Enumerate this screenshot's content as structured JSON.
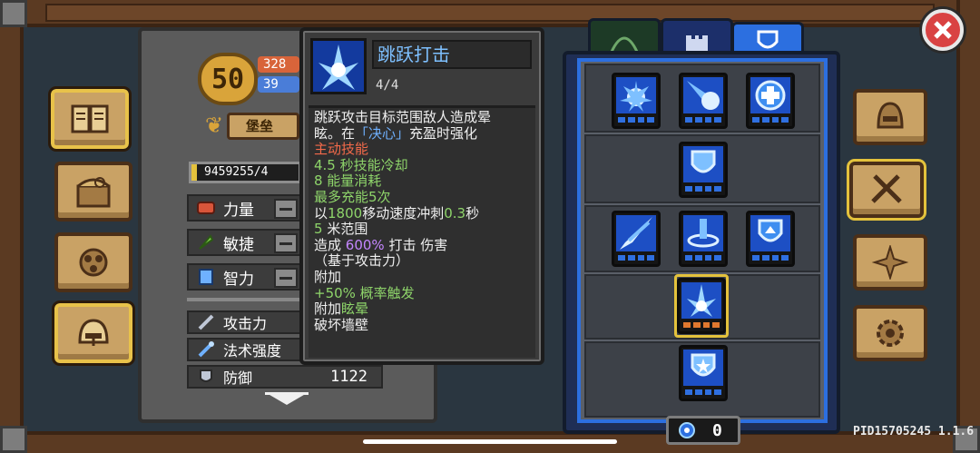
{
  "character": {
    "level": "50",
    "hp": "328",
    "mp": "39",
    "title": "堡垒",
    "experience": "9459255/4",
    "attributes": [
      {
        "label": "力量"
      },
      {
        "label": "敏捷"
      },
      {
        "label": "智力"
      }
    ],
    "stats": [
      {
        "label": "攻击力",
        "value": ""
      },
      {
        "label": "法术强度",
        "value": ""
      },
      {
        "label": "防御",
        "value": "1122"
      }
    ]
  },
  "tooltip": {
    "name": "跳跃打击",
    "level": "4/4",
    "lines": [
      {
        "parts": [
          {
            "t": "跳跃攻击目标范围敌人造成晕",
            "c": ""
          }
        ]
      },
      {
        "parts": [
          {
            "t": "眩。在",
            "c": ""
          },
          {
            "t": "「决心」",
            "c": "c-blue"
          },
          {
            "t": "充盈时强化",
            "c": ""
          }
        ]
      },
      {
        "parts": [
          {
            "t": "主动技能",
            "c": "c-red"
          }
        ]
      },
      {
        "parts": [
          {
            "t": "4.5 秒技能冷却",
            "c": "c-green"
          }
        ]
      },
      {
        "parts": [
          {
            "t": "8 能量消耗",
            "c": "c-green"
          }
        ]
      },
      {
        "parts": [
          {
            "t": "最多充能5次",
            "c": "c-green"
          }
        ]
      },
      {
        "parts": [
          {
            "t": "以",
            "c": ""
          },
          {
            "t": "1800",
            "c": "c-green"
          },
          {
            "t": "移动速度冲刺",
            "c": ""
          },
          {
            "t": "0.3",
            "c": "c-green"
          },
          {
            "t": "秒",
            "c": ""
          }
        ]
      },
      {
        "parts": [
          {
            "t": "5",
            "c": "c-green"
          },
          {
            "t": " 米范围",
            "c": ""
          }
        ]
      },
      {
        "parts": [
          {
            "t": "造成 ",
            "c": ""
          },
          {
            "t": "600%",
            "c": "c-purple"
          },
          {
            "t": " 打击 伤害",
            "c": ""
          }
        ]
      },
      {
        "parts": [
          {
            "t": "（基于攻击力）",
            "c": ""
          }
        ]
      },
      {
        "parts": [
          {
            "t": "附加",
            "c": ""
          }
        ]
      },
      {
        "parts": [
          {
            "t": "+50% 概率触发",
            "c": "c-green"
          }
        ]
      },
      {
        "parts": [
          {
            "t": "附加",
            "c": ""
          },
          {
            "t": "眩晕",
            "c": "c-green"
          }
        ]
      },
      {
        "parts": [
          {
            "t": "破坏墙壁",
            "c": ""
          }
        ]
      }
    ]
  },
  "skill_tree": {
    "tabs": [
      {
        "icon": "bow-icon",
        "selected": false
      },
      {
        "icon": "castle-icon",
        "selected": false
      },
      {
        "icon": "shield-icon",
        "selected": true
      }
    ],
    "currency": "0"
  },
  "version": "PID15705245 1.1.6",
  "colors": {
    "accent_blue": "#2c6fe0",
    "wood": "#c9a265",
    "close_red": "#d94242"
  }
}
